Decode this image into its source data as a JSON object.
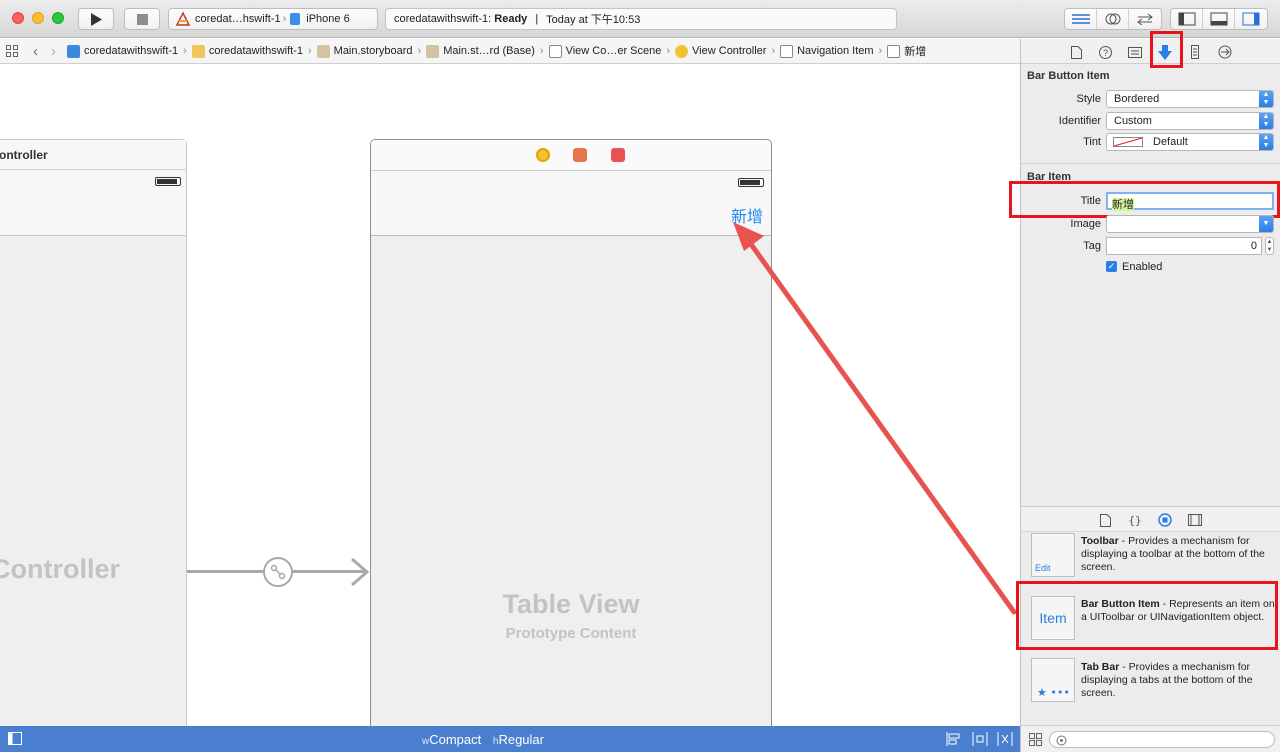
{
  "toolbar": {
    "run_label": "Run",
    "stop_label": "Stop",
    "scheme_name": "coredat…hswift-1",
    "device_name": "iPhone 6",
    "activity_project": "coredatawithswift-1:",
    "activity_status": "Ready",
    "activity_separator": "|",
    "activity_time": "Today at 下午10:53"
  },
  "jumpbar": {
    "crumbs": [
      "coredatawithswift-1",
      "coredatawithswift-1",
      "Main.storyboard",
      "Main.st…rd (Base)",
      "View Co…er Scene",
      "View Controller",
      "Navigation Item",
      "新增"
    ]
  },
  "canvas": {
    "left_scene_title": "ontroller",
    "left_scene_big_label": "Controller",
    "right_scene_nav_button": "新增",
    "table_view_label": "Table View",
    "prototype_label": "Prototype Content"
  },
  "bottombar": {
    "width_prefix": "w",
    "width_class": "Compact",
    "height_prefix": "h",
    "height_class": "Regular"
  },
  "inspector": {
    "bar_button_item_header": "Bar Button Item",
    "style_label": "Style",
    "style_value": "Bordered",
    "identifier_label": "Identifier",
    "identifier_value": "Custom",
    "tint_label": "Tint",
    "tint_value": "Default",
    "bar_item_header": "Bar Item",
    "title_label": "Title",
    "title_value": "新增",
    "image_label": "Image",
    "image_value": "",
    "tag_label": "Tag",
    "tag_value": "0",
    "enabled_label": "Enabled"
  },
  "library": {
    "items": [
      {
        "name": "Toolbar",
        "desc": " - Provides a mechanism for displaying a toolbar at the bottom of the screen.",
        "thumb_label": "Edit"
      },
      {
        "name": "Bar Button Item",
        "desc": " - Represents an item on a UIToolbar or UINavigationItem object.",
        "thumb_label": "Item"
      },
      {
        "name": "Tab Bar",
        "desc": " - Provides a mechanism for displaying a tabs at the bottom of the screen.",
        "thumb_label": "★ •••"
      }
    ]
  },
  "colors": {
    "accent": "#1d8bf1",
    "highlight": "#e8141b",
    "arrow": "#e8534f",
    "bottombar": "#4a7fcf"
  }
}
